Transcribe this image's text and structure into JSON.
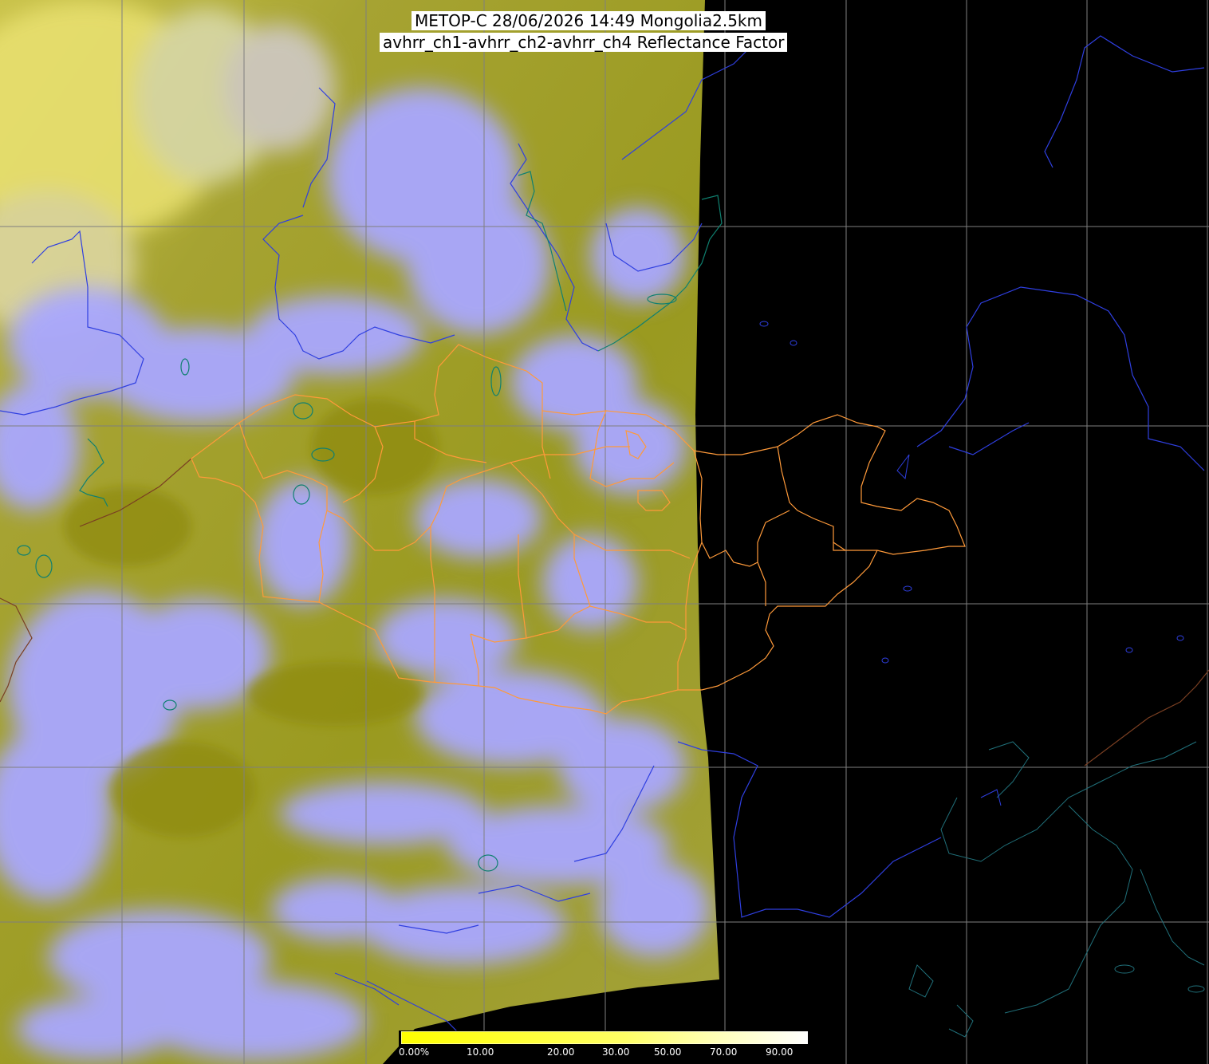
{
  "header": {
    "title_line1": "METOP-C 28/06/2026 14:49 Mongolia2.5km",
    "title_line2": "avhrr_ch1-avhrr_ch2-avhrr_ch4 Reflectance Factor"
  },
  "map": {
    "region": "Mongolia",
    "resolution": "2.5km",
    "satellite": "METOP-C",
    "channels": [
      "avhrr_ch1",
      "avhrr_ch2",
      "avhrr_ch4"
    ],
    "colors": {
      "background": "#000000",
      "clear_land": "#9a9a1e",
      "cloud": "#a8a8ff",
      "graticule": "#808080",
      "coastline": "#2a3bd8",
      "country_border": "#6b3a1e",
      "province_border": "#ff9a3a",
      "water_bodies": "#0f7060",
      "sea_coast": "#1f6f7a"
    }
  },
  "legend": {
    "labels": [
      "0.00%",
      "10.00",
      "20.00",
      "30.00",
      "50.00",
      "70.00",
      "90.00"
    ],
    "colors": [
      "#ffff00",
      "#ffffa0",
      "#ffffff"
    ]
  }
}
